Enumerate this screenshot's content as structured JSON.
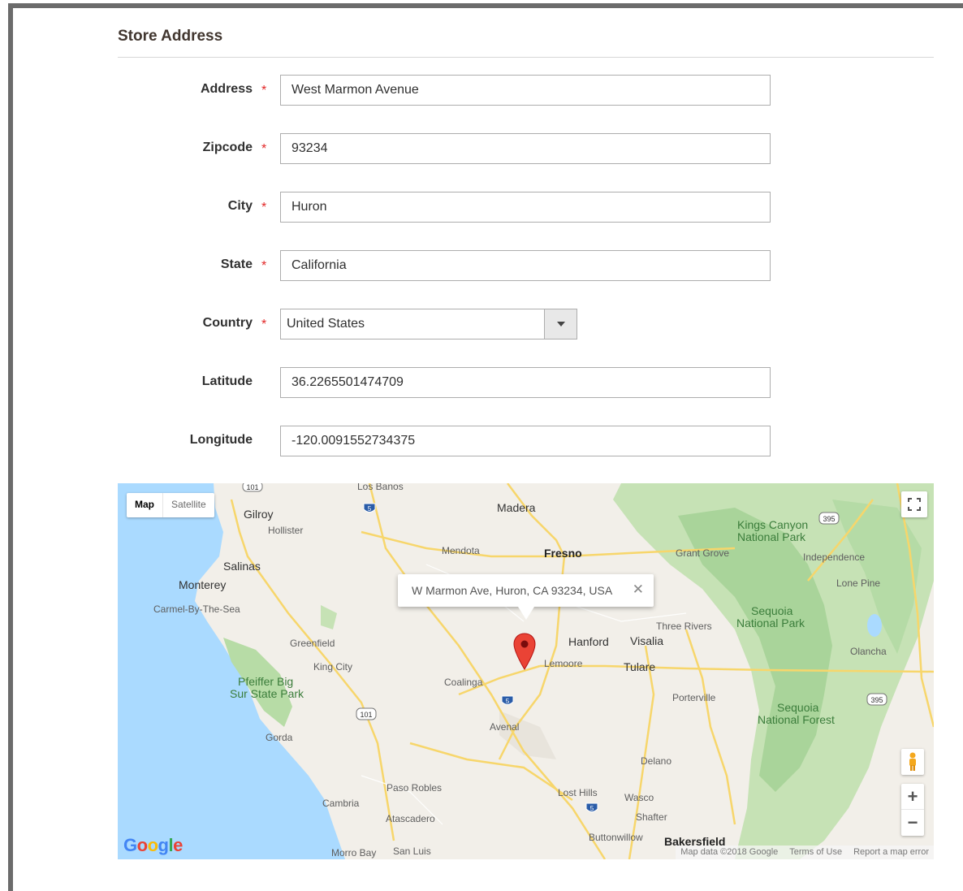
{
  "section": {
    "title": "Store Address"
  },
  "fields": [
    {
      "label": "Address",
      "required": true,
      "value": "West Marmon Avenue"
    },
    {
      "label": "Zipcode",
      "required": true,
      "value": "93234"
    },
    {
      "label": "City",
      "required": true,
      "value": "Huron"
    },
    {
      "label": "State",
      "required": true,
      "value": "California"
    },
    {
      "label": "Country",
      "required": true,
      "value": "United States",
      "type": "select"
    },
    {
      "label": "Latitude",
      "required": false,
      "value": "36.2265501474709"
    },
    {
      "label": "Longitude",
      "required": false,
      "value": "-120.0091552734375"
    }
  ],
  "required_mark": "*",
  "map": {
    "type_controls": {
      "map": "Map",
      "satellite": "Satellite"
    },
    "info_window": {
      "text": "W Marmon Ave, Huron, CA 93234, USA",
      "close": "✕"
    },
    "zoom": {
      "in": "+",
      "out": "−"
    },
    "logo": {
      "g1": "G",
      "g2": "o",
      "g3": "o",
      "g4": "g",
      "g5": "l",
      "g6": "e"
    },
    "attribution": {
      "data": "Map data ©2018 Google",
      "terms": "Terms of Use",
      "report": "Report a map error"
    },
    "places": {
      "los_banos": "Los Banos",
      "gilroy": "Gilroy",
      "hollister": "Hollister",
      "salinas": "Salinas",
      "monterey": "Monterey",
      "carmel": "Carmel-By-The-Sea",
      "madera": "Madera",
      "mendota": "Mendota",
      "fresno": "Fresno",
      "grant_grove": "Grant Grove",
      "kings_canyon": "Kings Canyon",
      "kings_canyon_2": "National Park",
      "independence": "Independence",
      "lone_pine": "Lone Pine",
      "sequoia_np": "Sequoia",
      "sequoia_np_2": "National Park",
      "three_rivers": "Three Rivers",
      "hanford": "Hanford",
      "visalia": "Visalia",
      "lemoore": "Lemoore",
      "tulare": "Tulare",
      "olancha": "Olancha",
      "greenfield": "Greenfield",
      "king_city": "King City",
      "coalinga": "Coalinga",
      "pfeiffer": "Pfeiffer Big",
      "pfeiffer_2": "Sur State Park",
      "avenal": "Avenal",
      "porterville": "Porterville",
      "sequoia_nf": "Sequoia",
      "sequoia_nf_2": "National Forest",
      "gorda": "Gorda",
      "delano": "Delano",
      "paso_robles": "Paso Robles",
      "lost_hills": "Lost Hills",
      "wasco": "Wasco",
      "cambria": "Cambria",
      "shafter": "Shafter",
      "atascadero": "Atascadero",
      "buttonwillow": "Buttonwillow",
      "bakersfield": "Bakersfield",
      "morro_bay": "Morro Bay",
      "san_luis": "San Luis"
    },
    "shields": {
      "us101_a": "101",
      "i5_a": "5",
      "i5_b": "5",
      "us101_b": "101",
      "i5_c": "5",
      "us395_a": "395",
      "us395_b": "395"
    }
  }
}
